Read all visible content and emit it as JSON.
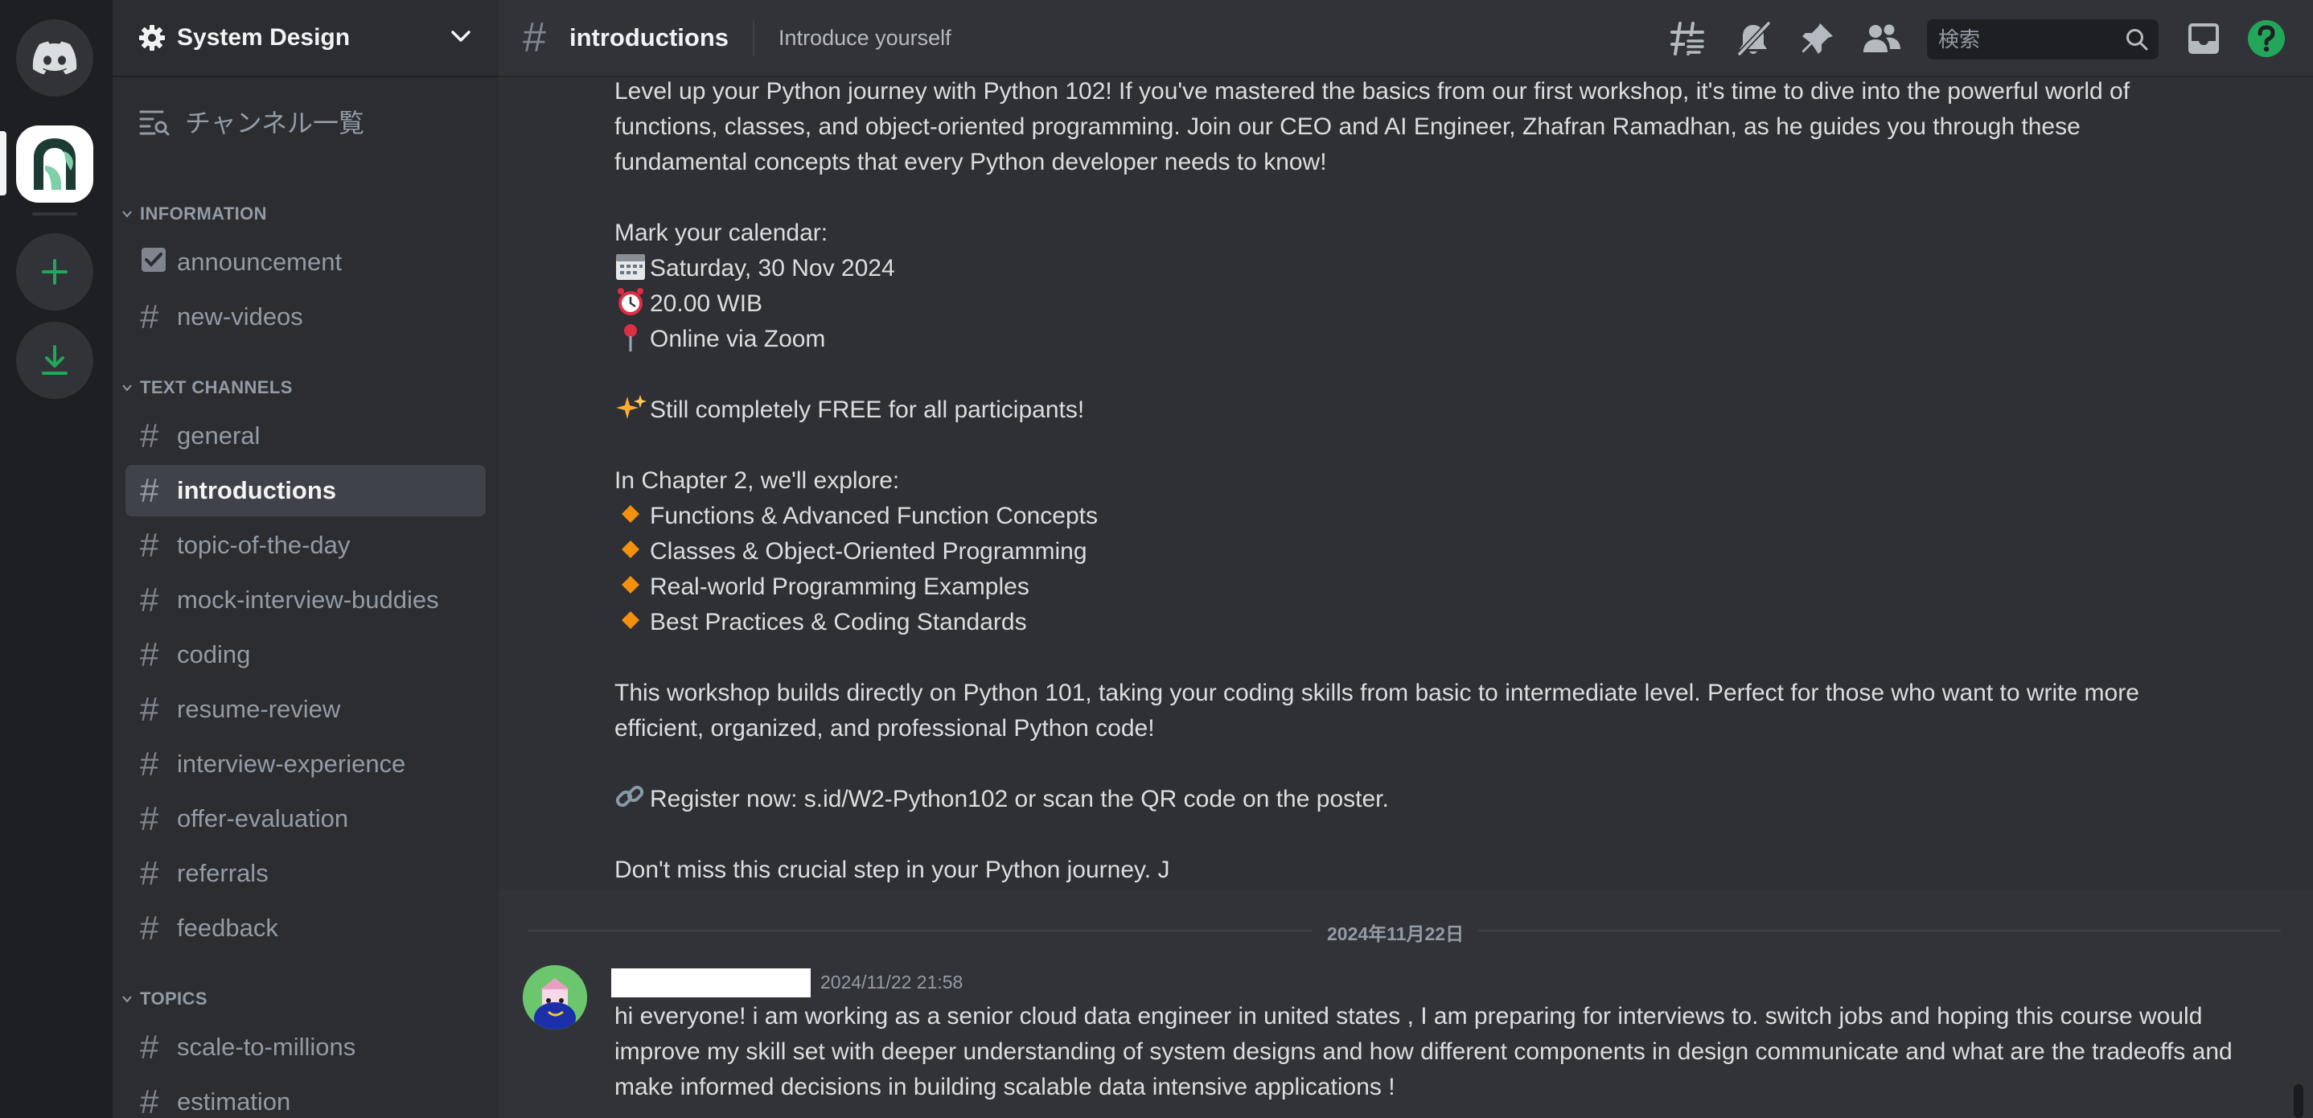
{
  "server_list": {
    "items": [
      {
        "name": "Direct Messages",
        "icon": "discord-logo-icon"
      },
      {
        "name": "System Design server",
        "icon": "server-logo-icon",
        "selected": true
      },
      {
        "name": "Add a Server",
        "icon": "plus-icon"
      },
      {
        "name": "Download Apps",
        "icon": "download-icon"
      }
    ]
  },
  "server": {
    "name": "System Design",
    "browse_label": "チャンネル一覧"
  },
  "categories": {
    "information": "INFORMATION",
    "text_channels": "TEXT CHANNELS",
    "topics": "TOPICS"
  },
  "channels": {
    "information": [
      "announcement",
      "new-videos"
    ],
    "text": [
      "general",
      "introductions",
      "topic-of-the-day",
      "mock-interview-buddies",
      "coding",
      "resume-review",
      "interview-experience",
      "offer-evaluation",
      "referrals",
      "feedback"
    ],
    "topics": [
      "scale-to-millions",
      "estimation"
    ],
    "active": "introductions"
  },
  "header": {
    "channel": "introductions",
    "topic": "Introduce yourself",
    "search_placeholder": "検索",
    "icons": [
      "threads-icon",
      "mute-bell-icon",
      "pin-icon",
      "member-list-icon",
      "inbox-icon",
      "help-icon"
    ]
  },
  "messages": {
    "event": {
      "intro_1": "Level up your Python journey with Python 102! If you've mastered the basics from our first workshop, it's time to dive into the powerful world of",
      "intro_2": "functions, classes, and object-oriented programming. Join our CEO and AI Engineer, Zhafran Ramadhan, as he guides you through these",
      "intro_3": "fundamental concepts that every Python developer needs to know!",
      "calendar_heading": "Mark your calendar:",
      "date": "Saturday, 30 Nov 2024",
      "time": "20.00 WIB",
      "venue": "Online via Zoom",
      "free": "Still completely FREE for all participants!",
      "chapter_heading": "In Chapter 2, we'll explore:",
      "topics": [
        "Functions & Advanced Function Concepts",
        "Classes & Object-Oriented Programming",
        "Real-world Programming Examples",
        "Best Practices & Coding Standards"
      ],
      "builds_1": "This workshop builds directly on Python 101, taking your coding skills from basic to intermediate level. Perfect for those who want to write more",
      "builds_2": "efficient, organized, and professional Python code!",
      "register": "Register now: s.id/W2-Python102 or scan the QR code on the poster.",
      "closing": "Don't miss this crucial step in your Python journey. J"
    },
    "date_divider": "2024年11月22日",
    "post": {
      "timestamp": "2024/11/22 21:58",
      "text": "hi everyone! i am working as a senior cloud data engineer in united states , I am preparing for  interviews to. switch jobs  and hoping this course would improve my skill set with deeper understanding of system designs and how different components in design communicate and what are the tradeoffs and make informed decisions in building scalable data intensive applications !"
    }
  },
  "colors": {
    "accent_green": "#23a55a",
    "diamond_orange": "#f4900c",
    "background": "#313338",
    "sidebar": "#2b2d31",
    "server_rail": "#1e1f22"
  }
}
